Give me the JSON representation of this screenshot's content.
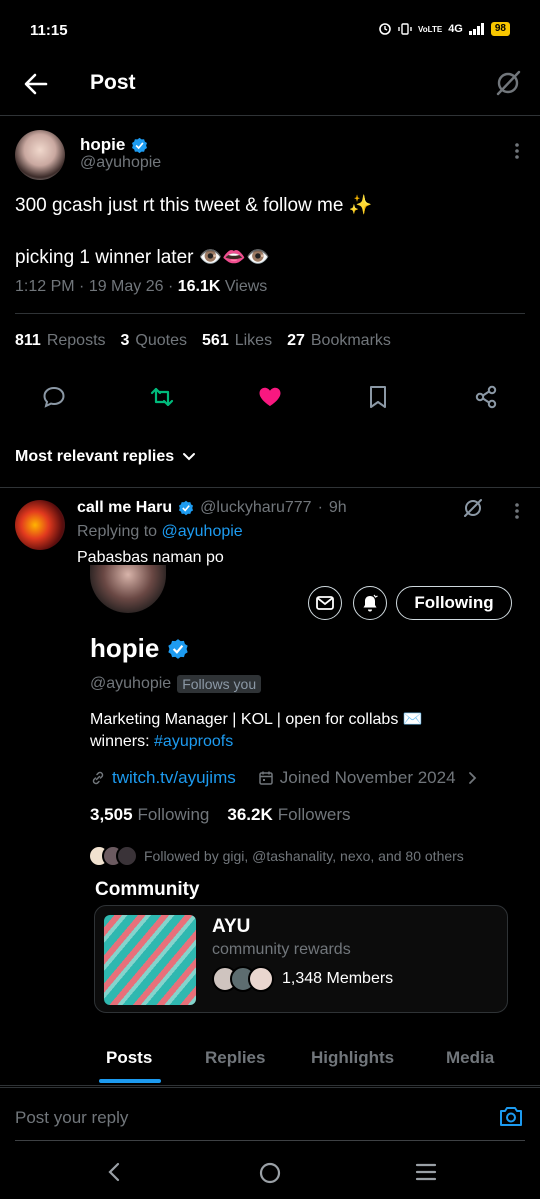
{
  "status_bar": {
    "time": "11:15",
    "network": "4G",
    "volte": "VoLTE",
    "battery": "98"
  },
  "header": {
    "title": "Post"
  },
  "post": {
    "author_name": "hopie",
    "author_handle": "@ayuhopie",
    "text_line1": "300 gcash just rt this tweet & follow me ✨",
    "text_line2": "picking 1 winner later 👁️👄👁️",
    "time": "1:12 PM",
    "date": "19 May 26",
    "views_count": "16.1K",
    "views_label": "Views",
    "reposts_count": "811",
    "reposts_label": "Reposts",
    "quotes_count": "3",
    "quotes_label": "Quotes",
    "likes_count": "561",
    "likes_label": "Likes",
    "bookmarks_count": "27",
    "bookmarks_label": "Bookmarks"
  },
  "replies_sort": {
    "label": "Most relevant replies"
  },
  "reply": {
    "name": "call me Haru",
    "handle": "@luckyharu777",
    "age": "9h",
    "replying_to_label": "Replying to",
    "replying_to_handle": "@ayuhopie",
    "text": "Pabasbas naman po"
  },
  "profile_card": {
    "name": "hopie",
    "handle": "@ayuhopie",
    "follows_you": "Follows you",
    "following_button": "Following",
    "bio_line1": "Marketing Manager | KOL | open for collabs ✉️",
    "bio_line2_prefix": "winners:",
    "bio_hashtag": "#ayuproofs",
    "link": "twitch.tv/ayujims",
    "joined": "Joined November 2024",
    "following_count": "3,505",
    "following_label": "Following",
    "followers_count": "36.2K",
    "followers_label": "Followers",
    "followed_by": "Followed by gigi, @tashanality, nexo, and 80 others",
    "community_title": "Community",
    "community_name": "AYU",
    "community_desc": "community rewards",
    "community_members": "1,348 Members"
  },
  "tabs": [
    "Posts",
    "Replies",
    "Highlights",
    "Media"
  ],
  "reply_bar": {
    "placeholder": "Post your reply"
  },
  "colors": {
    "accent": "#1d9bf0",
    "like": "#f91880",
    "repost": "#00ba7c",
    "background": "#000000"
  }
}
